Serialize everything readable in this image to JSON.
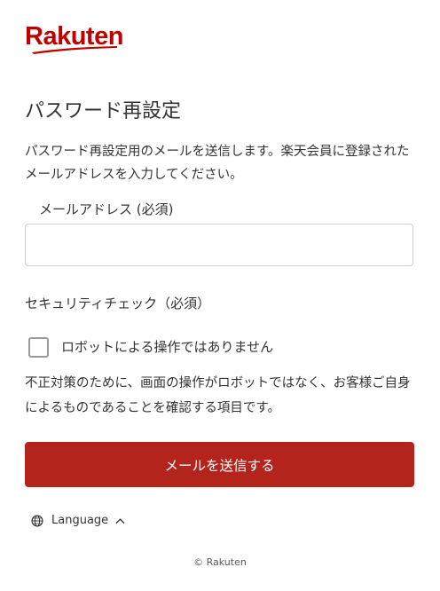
{
  "brand": {
    "name": "Rakuten",
    "color": "#bf0000"
  },
  "page": {
    "title": "パスワード再設定",
    "description": "パスワード再設定用のメールを送信します。楽天会員に登録されたメールアドレスを入力してください。"
  },
  "email": {
    "label": "メールアドレス (必須)",
    "value": "",
    "placeholder": ""
  },
  "security": {
    "label": "セキュリティチェック（必須）",
    "captcha_label": "ロボットによる操作ではありません",
    "captcha_checked": false,
    "note": "不正対策のために、画面の操作がロボットではなく、お客様ご自身によるものであることを確認する項目です。"
  },
  "submit": {
    "label": "メールを送信する",
    "color": "#b3251c"
  },
  "language": {
    "label": "Language",
    "icon": "globe-icon",
    "chevron": "chevron-up-icon"
  },
  "footer": {
    "copyright": "© Rakuten"
  }
}
